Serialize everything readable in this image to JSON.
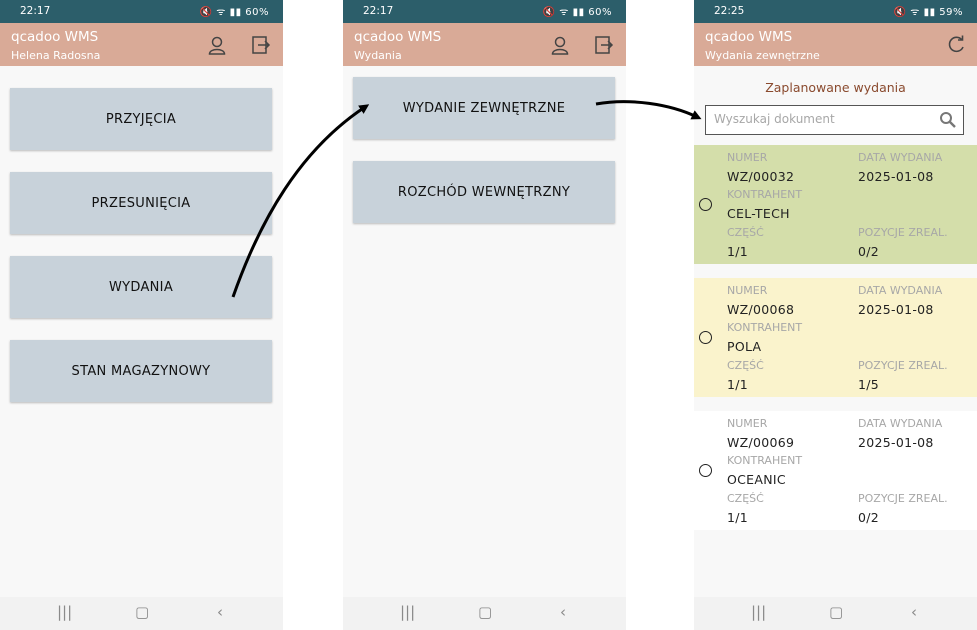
{
  "screens": [
    {
      "status": {
        "time": "22:17",
        "battery": "60%"
      },
      "app_title": "qcadoo WMS",
      "subtitle": "Helena Radosna",
      "buttons": [
        "PRZYJĘCIA",
        "PRZESUNIĘCIA",
        "WYDANIA",
        "STAN MAGAZYNOWY"
      ]
    },
    {
      "status": {
        "time": "22:17",
        "battery": "60%"
      },
      "app_title": "qcadoo WMS",
      "subtitle": "Wydania",
      "buttons": [
        "WYDANIE ZEWNĘTRZNE",
        "ROZCHÓD WEWNĘTRZNY"
      ]
    },
    {
      "status": {
        "time": "22:25",
        "battery": "59%"
      },
      "app_title": "qcadoo WMS",
      "subtitle": "Wydania zewnętrzne",
      "heading": "Zaplanowane wydania",
      "search": {
        "placeholder": "Wyszukaj dokument"
      },
      "labels": {
        "numer": "NUMER",
        "data": "DATA WYDANIA",
        "kontrahent": "KONTRAHENT",
        "czesc": "CZĘŚĆ",
        "pozycje": "POZYCJE ZREAL."
      },
      "documents": [
        {
          "numer": "WZ/00032",
          "data": "2025-01-08",
          "kontrahent": "CEL-TECH",
          "czesc": "1/1",
          "pozycje": "0/2",
          "bg": "#d4deaa"
        },
        {
          "numer": "WZ/00068",
          "data": "2025-01-08",
          "kontrahent": "POLA",
          "czesc": "1/1",
          "pozycje": "1/5",
          "bg": "#faf3cc"
        },
        {
          "numer": "WZ/00069",
          "data": "2025-01-08",
          "kontrahent": "OCEANIC",
          "czesc": "1/1",
          "pozycje": "0/2",
          "bg": "#ffffff"
        }
      ]
    }
  ],
  "colors": {
    "statusbar": "#2c5e6a",
    "appbar": "#d9aa97",
    "button": "#c8d2da",
    "heading": "#8a4a2e"
  },
  "icons": [
    "user-icon",
    "logout-icon",
    "refresh-icon",
    "search-icon",
    "recents-icon",
    "home-icon",
    "back-icon"
  ]
}
